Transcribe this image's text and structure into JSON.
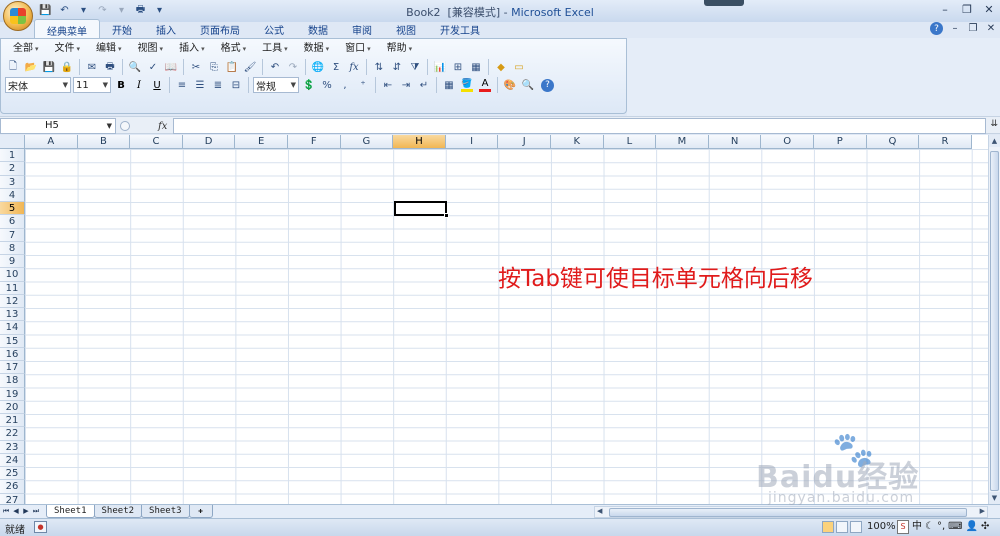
{
  "titlebar": {
    "doc": "Book2",
    "mode": "[兼容模式]",
    "dash": "-",
    "app": "Microsoft Excel",
    "qat_dropdown": "▾"
  },
  "tabs": [
    "经典菜单",
    "开始",
    "插入",
    "页面布局",
    "公式",
    "数据",
    "审阅",
    "视图",
    "开发工具"
  ],
  "menus": [
    "全部",
    "文件",
    "编辑",
    "视图",
    "插入",
    "格式",
    "工具",
    "数据",
    "窗口",
    "帮助"
  ],
  "format_bar": {
    "font": "宋体",
    "size": "11",
    "bold": "B",
    "italic": "I",
    "underline": "U",
    "number_format": "常规",
    "percent": "%",
    "comma": ","
  },
  "formula_bar": {
    "name_box": "H5",
    "fx": "fx",
    "value": ""
  },
  "columns": [
    "A",
    "B",
    "C",
    "D",
    "E",
    "F",
    "G",
    "H",
    "I",
    "J",
    "K",
    "L",
    "M",
    "N",
    "O",
    "P",
    "Q",
    "R"
  ],
  "rows": [
    "1",
    "2",
    "3",
    "4",
    "5",
    "6",
    "7",
    "8",
    "9",
    "10",
    "11",
    "12",
    "13",
    "14",
    "15",
    "16",
    "17",
    "18",
    "19",
    "20",
    "21",
    "22",
    "23",
    "24",
    "25",
    "26",
    "27"
  ],
  "selected_cell": {
    "column": "H",
    "row": "5"
  },
  "annotation": "按Tab键可使目标单元格向后移",
  "sheets": [
    "Sheet1",
    "Sheet2",
    "Sheet3"
  ],
  "active_sheet": "Sheet1",
  "status": {
    "ready": "就绪",
    "zoom": "100%",
    "ime_chinese": "中"
  },
  "watermark": {
    "brand": "Baidu经验",
    "url": "jingyan.baidu.com"
  },
  "colors": {
    "accent": "#15428b",
    "selected_header": "#f1b654",
    "annotation": "#e01b1b"
  }
}
